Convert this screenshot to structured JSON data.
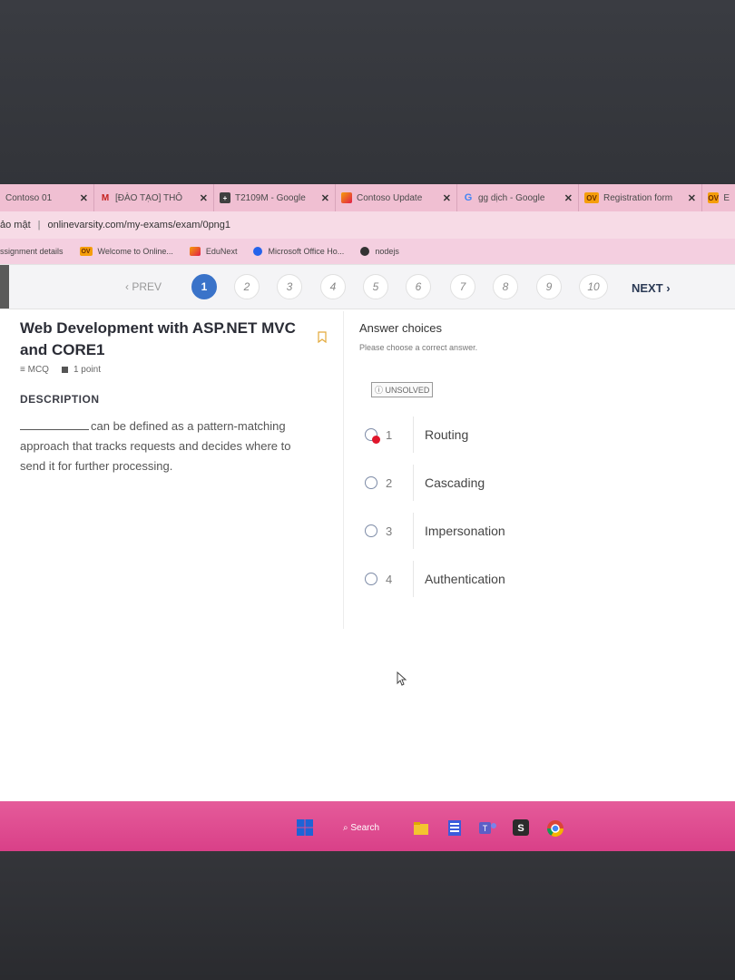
{
  "browser": {
    "tabs": [
      {
        "label": "Contoso 01",
        "icon": "page-icon"
      },
      {
        "label": "[ĐÀO TẠO] THÔ",
        "icon": "gmail-icon"
      },
      {
        "label": "T2109M - Google",
        "icon": "classroom-icon"
      },
      {
        "label": "Contoso Update",
        "icon": "edunext-icon"
      },
      {
        "label": "gg dịch - Google",
        "icon": "google-icon"
      },
      {
        "label": "Registration form",
        "icon": "ov-icon"
      },
      {
        "label": "E",
        "icon": "ov-icon"
      }
    ],
    "address_prefix": "ảo mật",
    "url": "onlinevarsity.com/my-exams/exam/0png1",
    "bookmarks": [
      {
        "label": "ssignment details",
        "icon": ""
      },
      {
        "label": "Welcome to Online...",
        "icon": "ov-icon"
      },
      {
        "label": "EduNext",
        "icon": "edunext-icon"
      },
      {
        "label": "Microsoft Office Ho...",
        "icon": "office-icon"
      },
      {
        "label": "nodejs",
        "icon": "nodejs-icon"
      }
    ]
  },
  "pager": {
    "prev_label": "‹ PREV",
    "next_label": "NEXT ›",
    "questions": [
      "1",
      "2",
      "3",
      "4",
      "5",
      "6",
      "7",
      "8",
      "9",
      "10"
    ],
    "current": "1"
  },
  "question": {
    "title": "Web Development with ASP.NET MVC and CORE1",
    "type": "MCQ",
    "points": "1 point",
    "description_heading": "DESCRIPTION",
    "description_text": "can be defined as a pattern-matching approach that tracks requests and decides where to send it for further processing."
  },
  "answers": {
    "heading": "Answer choices",
    "subheading": "Please choose a correct answer.",
    "status": "ⓘ UNSOLVED",
    "options": [
      {
        "number": "1",
        "label": "Routing"
      },
      {
        "number": "2",
        "label": "Cascading"
      },
      {
        "number": "3",
        "label": "Impersonation"
      },
      {
        "number": "4",
        "label": "Authentication"
      }
    ]
  },
  "taskbar": {
    "search_label": "Search"
  },
  "colors": {
    "tabbar": "#f0bfd2",
    "accent": "#3a73c9",
    "taskbar": "#d94088",
    "marker": "#e0162b"
  }
}
